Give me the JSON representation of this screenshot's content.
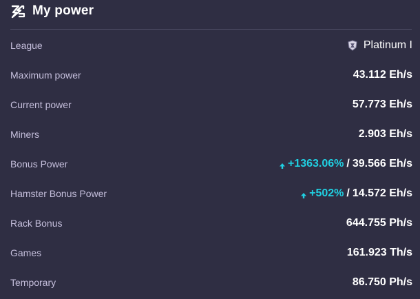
{
  "header": {
    "title": "My power",
    "icon": "lightning-logo-icon"
  },
  "colors": {
    "background": "#2f2e43",
    "label": "#c5bfdc",
    "value": "#ffffff",
    "bonus": "#20d0e2",
    "divider": "#4c4b63"
  },
  "rows": {
    "league": {
      "label": "League",
      "value": "Platinum I",
      "icon": "league-badge-icon"
    },
    "max_power": {
      "label": "Maximum power",
      "value": "43.112 Eh/s"
    },
    "current_power": {
      "label": "Current power",
      "value": "57.773 Eh/s"
    },
    "miners": {
      "label": "Miners",
      "value": "2.903 Eh/s"
    },
    "bonus_power": {
      "label": "Bonus Power",
      "percent": "+1363.06%",
      "separator": "/",
      "value": "39.566 Eh/s",
      "icon": "arrow-up-icon"
    },
    "hamster_bonus": {
      "label": "Hamster Bonus Power",
      "percent": "+502%",
      "separator": "/",
      "value": "14.572 Eh/s",
      "icon": "arrow-up-icon"
    },
    "rack_bonus": {
      "label": "Rack Bonus",
      "value": "644.755 Ph/s"
    },
    "games": {
      "label": "Games",
      "value": "161.923 Th/s"
    },
    "temporary": {
      "label": "Temporary",
      "value": "86.750 Ph/s"
    }
  }
}
